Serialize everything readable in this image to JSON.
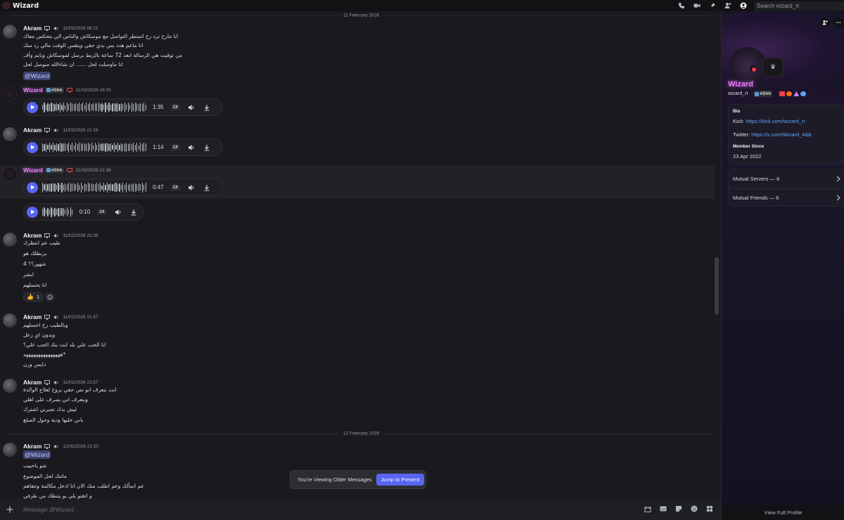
{
  "app": {
    "title": "Wizard",
    "search_placeholder": "Search wizard_rt"
  },
  "dividers": [
    "11 February 2026",
    "12 February 2026"
  ],
  "messages": [
    {
      "author": "Akram",
      "timestamp": "11/02/2026 06:21",
      "lines": [
        "انا مارح ترد رح استطر التواصل مع موسكاش والناس الي بتحكس معاك",
        "انا ماعم هدد بس بدي حقي ويتقس الوقت مالي رد منك",
        "من توقيت هي الرسالة ابعد 72 ساعة بالزبط برسل لموسكاش وبايم وأف",
        "انا ماوسلت لحل ...... ان شاءالله منوصل لحل"
      ],
      "mention": "@Wizard"
    },
    {
      "author": "Wizard",
      "tag": "#Shh",
      "timestamp": "11/02/2026 16:25",
      "voice": {
        "duration": "1:35",
        "speed": "1X"
      }
    },
    {
      "author": "Akram",
      "timestamp": "11/02/2026 21:19",
      "voice": {
        "duration": "1:14",
        "speed": "1X"
      }
    },
    {
      "author": "Wizard",
      "tag": "#Shh",
      "timestamp": "11/02/2026 21:38",
      "voice": {
        "duration": "0:47",
        "speed": "1X"
      },
      "voice2": {
        "duration": "0:10",
        "speed": "1X"
      }
    },
    {
      "author": "Akram",
      "timestamp": "11/02/2026 21:39",
      "lines": [
        "طيب عم انتظرك",
        "بزبطلك هو",
        "4 شهور؟؟",
        "ابشر",
        "انا بحسلهم"
      ],
      "reaction": {
        "emoji": "👍",
        "count": "1"
      }
    },
    {
      "author": "Akram",
      "timestamp": "11/02/2026 21:47",
      "lines": [
        "وبالطيب رح احسلهم",
        "وبدون اي زعل",
        "انا الحب علي بلد انت بنك الحب علي؟",
        "هههههههههههههههه*",
        "دايس ورن"
      ]
    },
    {
      "author": "Akram",
      "timestamp": "11/02/2026 23:57",
      "lines": [
        "انت بتعرف انو نص حقي بروح لعلاج الوالدة",
        "وبتعرف اني بصرف على اهلي",
        "ليش بدك تجبرني اشترك",
        "باني خليها ودية وحول المبلغ"
      ]
    },
    {
      "author": "Akram",
      "timestamp": "12/02/2026 21:50",
      "mention": "@Wizard",
      "lines": [
        "شو ياحبيب",
        "ماتنك لحل الموضوع",
        "عم اسألك وعم اطلب منك الان انا ادخل مكالمة وتتفاهم",
        "و انقتو بلي بو يتنظك من طرفي"
      ]
    }
  ],
  "banner": {
    "viewing": "You're Viewing Older Messages",
    "jump": "Jump to Present"
  },
  "composer": {
    "placeholder": "Message @Wizard"
  },
  "profile": {
    "display_name": "Wizard",
    "username": "wizard_rt",
    "tag": "#Shh",
    "bio_label": "Bio",
    "bio_kick_prefix": "Kick: ",
    "bio_kick_url": "https://kick.com/wizard_rt",
    "bio_twitter_prefix": "Twitter: ",
    "bio_twitter_url": "https://x.com/Wizard_Abb",
    "member_since_label": "Member Since",
    "member_since": "23 Apr 2022",
    "mutual_servers": "Mutual Servers — 6",
    "mutual_friends": "Mutual Friends — 6",
    "view_full": "View Full Profile",
    "crown": "♛"
  },
  "colors": {
    "accent": "#5865f2",
    "nitro_name": "#e879f9",
    "link": "#60a5fa",
    "dnd": "#f23f43"
  }
}
